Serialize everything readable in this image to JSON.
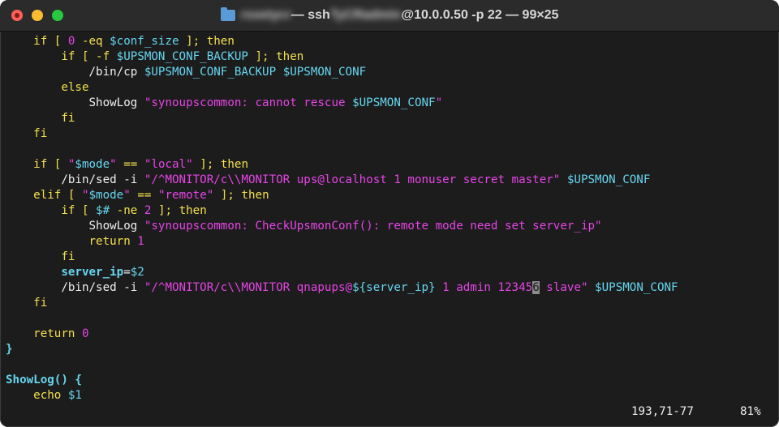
{
  "window": {
    "title_dir": "rssetycr",
    "title_sep": " — ssh ",
    "title_user": "TyCRadmin",
    "title_host": "@10.0.0.50 -p 22 — 99×25"
  },
  "lines": [
    [
      [
        "kw",
        "    if [ "
      ],
      [
        "num",
        "0"
      ],
      [
        "kw",
        " -eq "
      ],
      [
        "var",
        "$conf_size"
      ],
      [
        "kw",
        " ]; then"
      ]
    ],
    [
      [
        "kw",
        "        if [ -f "
      ],
      [
        "var",
        "$UPSMON_CONF_BACKUP"
      ],
      [
        "kw",
        " ]; then"
      ]
    ],
    [
      [
        "cmd",
        "            /bin/cp "
      ],
      [
        "var",
        "$UPSMON_CONF_BACKUP"
      ],
      [
        "cmd",
        " "
      ],
      [
        "var",
        "$UPSMON_CONF"
      ]
    ],
    [
      [
        "kw",
        "        else"
      ]
    ],
    [
      [
        "cmd",
        "            ShowLog "
      ],
      [
        "str",
        "\"synoupscommon: cannot rescue "
      ],
      [
        "var",
        "$UPSMON_CONF"
      ],
      [
        "str",
        "\""
      ]
    ],
    [
      [
        "kw",
        "        fi"
      ]
    ],
    [
      [
        "kw",
        "    fi"
      ]
    ],
    [
      [
        "cmd",
        ""
      ]
    ],
    [
      [
        "kw",
        "    if [ "
      ],
      [
        "str",
        "\""
      ],
      [
        "var",
        "$mode"
      ],
      [
        "str",
        "\""
      ],
      [
        "kw",
        " == "
      ],
      [
        "str",
        "\"local\""
      ],
      [
        "kw",
        " ]; then"
      ]
    ],
    [
      [
        "cmd",
        "        /bin/sed -i "
      ],
      [
        "str",
        "\"/^MONITOR/c\\\\MONITOR ups@localhost 1 monuser secret master\""
      ],
      [
        "cmd",
        " "
      ],
      [
        "var",
        "$UPSMON_CONF"
      ]
    ],
    [
      [
        "kw",
        "    elif [ "
      ],
      [
        "str",
        "\""
      ],
      [
        "var",
        "$mode"
      ],
      [
        "str",
        "\""
      ],
      [
        "kw",
        " == "
      ],
      [
        "str",
        "\"remote\""
      ],
      [
        "kw",
        " ]; then"
      ]
    ],
    [
      [
        "kw",
        "        if [ "
      ],
      [
        "var",
        "$#"
      ],
      [
        "kw",
        " -ne "
      ],
      [
        "num",
        "2"
      ],
      [
        "kw",
        " ]; then"
      ]
    ],
    [
      [
        "cmd",
        "            ShowLog "
      ],
      [
        "str",
        "\"synoupscommon: CheckUpsmonConf(): remote mode need set server_ip\""
      ]
    ],
    [
      [
        "kw",
        "            return "
      ],
      [
        "num",
        "1"
      ]
    ],
    [
      [
        "kw",
        "        fi"
      ]
    ],
    [
      [
        "fn",
        "        server_ip"
      ],
      [
        "cmd",
        "="
      ],
      [
        "var",
        "$2"
      ]
    ],
    [
      [
        "cmd",
        "        /bin/sed -i "
      ],
      [
        "str",
        "\"/^MONITOR/c\\\\MONITOR qnapups@"
      ],
      [
        "var",
        "${server_ip}"
      ],
      [
        "str",
        " 1 admin 12345"
      ],
      [
        "cursor",
        "6"
      ],
      [
        "str",
        " slave\""
      ],
      [
        "cmd",
        " "
      ],
      [
        "var",
        "$UPSMON_CONF"
      ]
    ],
    [
      [
        "kw",
        "    fi"
      ]
    ],
    [
      [
        "cmd",
        ""
      ]
    ],
    [
      [
        "kw",
        "    return "
      ],
      [
        "num",
        "0"
      ]
    ],
    [
      [
        "brace",
        "}"
      ]
    ],
    [
      [
        "cmd",
        ""
      ]
    ],
    [
      [
        "fn",
        "ShowLog() {"
      ]
    ],
    [
      [
        "kw",
        "    echo "
      ],
      [
        "var",
        "$1"
      ]
    ]
  ],
  "status": {
    "position": "193,71-77",
    "percent": "81%"
  }
}
